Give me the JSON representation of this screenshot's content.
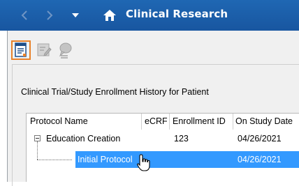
{
  "window": {
    "title": "Clinical Research",
    "back_icon": "chevron-left-icon",
    "forward_icon": "chevron-right-icon",
    "dropdown_icon": "caret-down-icon",
    "home_icon": "home-icon"
  },
  "toolbar": {
    "buttons": [
      {
        "name": "enrollment-form-icon",
        "state": "active"
      },
      {
        "name": "edit-document-icon",
        "state": "disabled"
      },
      {
        "name": "comment-icon",
        "state": "disabled"
      }
    ]
  },
  "section": {
    "title": "Clinical Trial/Study Enrollment History for Patient"
  },
  "grid": {
    "columns": [
      "Protocol Name",
      "eCRF",
      "Enrollment ID",
      "On Study Date"
    ],
    "rows": [
      {
        "name": "Education Creation",
        "ecrf": "",
        "enrollment_id": "123",
        "on_study_date": "04/26/2021",
        "expanded": true
      },
      {
        "name": "Initial Protocol",
        "ecrf": "",
        "enrollment_id": "",
        "on_study_date": "04/26/2021",
        "selected": true
      }
    ]
  },
  "colors": {
    "titlebar": "#1f67b3",
    "selection": "#3399ff",
    "active_button_border": "#e8822a"
  }
}
